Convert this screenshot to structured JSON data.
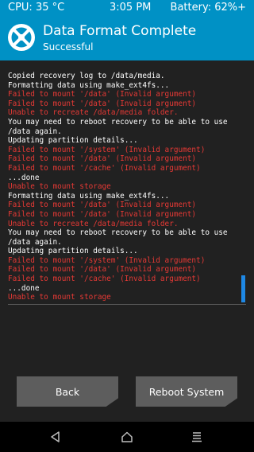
{
  "status_bar": {
    "cpu": "CPU: 35 °C",
    "time": "3:05 PM",
    "battery": "Battery: 62%+"
  },
  "header": {
    "title": "Data Format Complete",
    "subtitle": "Successful",
    "logo_icon": "twrp-logo-icon"
  },
  "log": {
    "lines": [
      {
        "text": "Copied recovery log to /data/media.",
        "type": "info"
      },
      {
        "text": "Formatting data using make_ext4fs...",
        "type": "info"
      },
      {
        "text": "Failed to mount '/data' (Invalid argument)",
        "type": "error"
      },
      {
        "text": "Failed to mount '/data' (Invalid argument)",
        "type": "error"
      },
      {
        "text": "Unable to recreate /data/media folder.",
        "type": "error"
      },
      {
        "text": "You may need to reboot recovery to be able to use",
        "type": "info"
      },
      {
        "text": "/data again.",
        "type": "info"
      },
      {
        "text": "Updating partition details...",
        "type": "info"
      },
      {
        "text": "Failed to mount '/system' (Invalid argument)",
        "type": "error"
      },
      {
        "text": "Failed to mount '/data' (Invalid argument)",
        "type": "error"
      },
      {
        "text": "Failed to mount '/cache' (Invalid argument)",
        "type": "error"
      },
      {
        "text": "...done",
        "type": "info"
      },
      {
        "text": "Unable to mount storage",
        "type": "error"
      },
      {
        "text": "Formatting data using make_ext4fs...",
        "type": "info"
      },
      {
        "text": "Failed to mount '/data' (Invalid argument)",
        "type": "error"
      },
      {
        "text": "Failed to mount '/data' (Invalid argument)",
        "type": "error"
      },
      {
        "text": "Unable to recreate /data/media folder.",
        "type": "error"
      },
      {
        "text": "You may need to reboot recovery to be able to use",
        "type": "info"
      },
      {
        "text": "/data again.",
        "type": "info"
      },
      {
        "text": "Updating partition details...",
        "type": "info"
      },
      {
        "text": "Failed to mount '/system' (Invalid argument)",
        "type": "error"
      },
      {
        "text": "Failed to mount '/data' (Invalid argument)",
        "type": "error"
      },
      {
        "text": "Failed to mount '/cache' (Invalid argument)",
        "type": "error"
      },
      {
        "text": "...done",
        "type": "info"
      },
      {
        "text": "Unable to mount storage",
        "type": "error"
      }
    ]
  },
  "buttons": {
    "back": "Back",
    "reboot": "Reboot System"
  },
  "nav": {
    "back_icon": "nav-back-icon",
    "home_icon": "nav-home-icon",
    "menu_icon": "nav-menu-icon"
  },
  "colors": {
    "accent": "#0091c5",
    "background": "#212121",
    "error_text": "#e53935",
    "button": "#5d5d5d",
    "scroll_thumb": "#1e88e5"
  }
}
